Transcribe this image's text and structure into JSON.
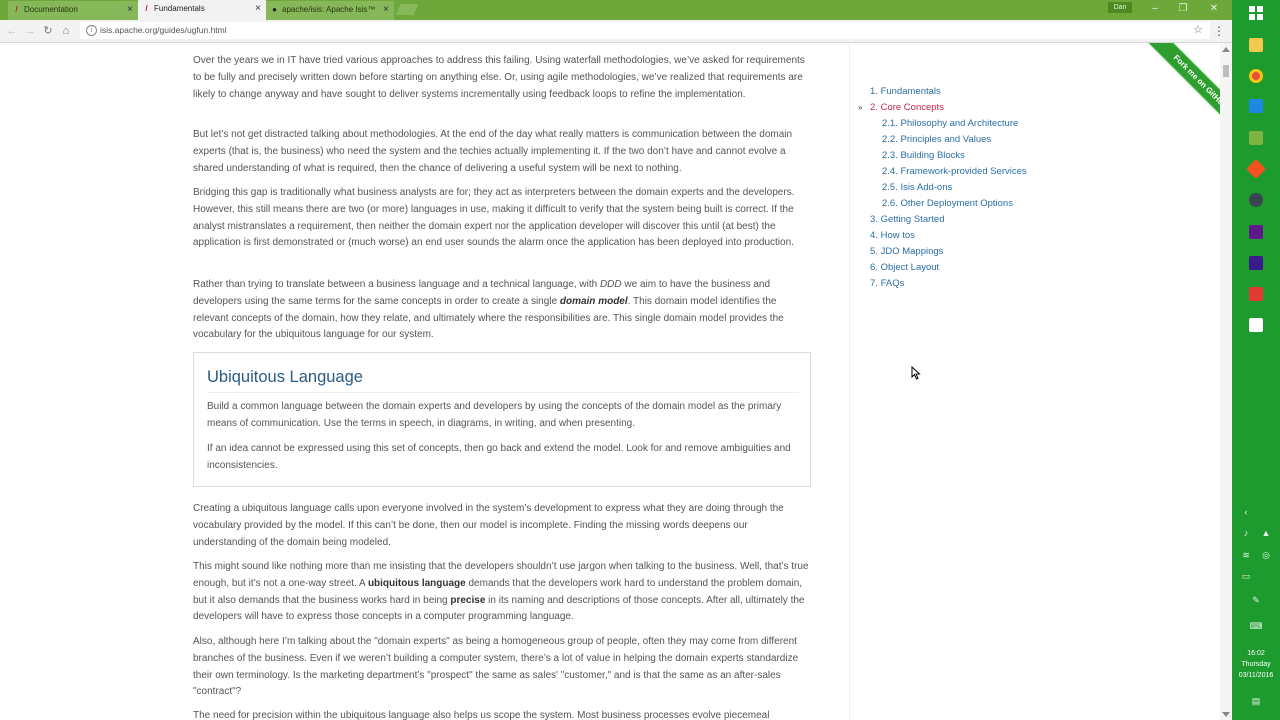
{
  "browser": {
    "tabs": [
      {
        "title": "Documentation",
        "active": false,
        "icon": "isis-favicon"
      },
      {
        "title": "Fundamentals",
        "active": true,
        "icon": "isis-favicon"
      },
      {
        "title": "apache/isis: Apache Isis™",
        "active": false,
        "icon": "github-icon"
      }
    ],
    "user_label": "Dan",
    "url": "isis.apache.org/guides/ugfun.html"
  },
  "page": {
    "paragraphs": [
      "Over the years we in IT have tried various approaches to address this failing. Using waterfall methodologies, we’ve asked for requirements to be fully and precisely written down before starting on anything else. Or, using agile methodologies, we’ve realized that requirements are likely to change anyway and have sought to deliver systems incrementally using feedback loops to refine the implementation.",
      "But let’s not get distracted talking about methodologies. At the end of the day what really matters is communication between the domain experts (that is, the business) who need the system and the techies actually implementing it. If the two don’t have and cannot evolve a shared understanding of what is required, then the chance of delivering a useful system will be next to nothing.",
      "Bridging this gap is traditionally what business analysts are for; they act as interpreters between the domain experts and the developers. However, this still means there are two (or more) languages in use, making it difficult to verify that the system being built is correct. If the analyst mistranslates a requirement, then neither the domain expert nor the application developer will discover this until (at best) the application is first demonstrated or (much worse) an end user sounds the alarm once the application has been deployed into production."
    ],
    "p4": {
      "a": "Rather than trying to translate between a business language and a technical language, with ",
      "ddd": "DDD",
      "b": " we aim to have the business and developers using the same terms for the same concepts in order to create a single ",
      "domain_model": "domain model",
      "c": ". This domain model identifies the relevant concepts of the domain, how they relate, and ultimately where the responsibilities are. This single domain model provides the vocabulary for the ubiquitous language for our system."
    },
    "callout": {
      "title": "Ubiquitous Language",
      "p1": "Build a common language between the domain experts and developers by using the concepts of the domain model as the primary means of communication. Use the terms in speech, in diagrams, in writing, and when presenting.",
      "p2": "If an idea cannot be expressed using this set of concepts, then go back and extend the model. Look for and remove ambiguities and inconsistencies."
    },
    "p5": "Creating a ubiquitous language calls upon everyone involved in the system’s development to express what they are doing through the vocabulary provided by the model. If this can’t be done, then our model is incomplete. Finding the missing words deepens our understanding of the domain being modeled.",
    "p6": {
      "a": "This might sound like nothing more than me insisting that the developers shouldn’t use jargon when talking to the business. Well, that’s true enough, but it’s not a one-way street. A ",
      "ul": "ubiquitous language",
      "b": " demands that the developers work hard to understand the problem domain, but it also demands that the business works hard in being ",
      "precise": "precise",
      "c": " in its naming and descriptions of those concepts. After all, ultimately the developers will have to express those concepts in a computer programming language."
    },
    "p7": "Also, although here I’m talking about the \"domain experts\" as being a homogeneous group of people, often they may come from different branches of the business. Even if we weren’t building a computer system, there’s a lot of value in helping the domain experts standardize their own terminology. Is the marketing department’s \"prospect\" the same as sales' \"customer,\" and is that the same as an after-sales \"contract\"?",
    "p8": "The need for precision within the ubiquitous language also helps us scope the system. Most business processes evolve piecemeal"
  },
  "toc": [
    {
      "num": "1.",
      "label": "Fundamentals",
      "level": 1,
      "active": false
    },
    {
      "num": "2.",
      "label": "Core Concepts",
      "level": 1,
      "active": true
    },
    {
      "num": "2.1.",
      "label": "Philosophy and Architecture",
      "level": 2,
      "active": false
    },
    {
      "num": "2.2.",
      "label": "Principles and Values",
      "level": 2,
      "active": false
    },
    {
      "num": "2.3.",
      "label": "Building Blocks",
      "level": 2,
      "active": false
    },
    {
      "num": "2.4.",
      "label": "Framework-provided Services",
      "level": 2,
      "active": false
    },
    {
      "num": "2.5.",
      "label": "Isis Add-ons",
      "level": 2,
      "active": false
    },
    {
      "num": "2.6.",
      "label": "Other Deployment Options",
      "level": 2,
      "active": false
    },
    {
      "num": "3.",
      "label": "Getting Started",
      "level": 1,
      "active": false
    },
    {
      "num": "4.",
      "label": "How tos",
      "level": 1,
      "active": false
    },
    {
      "num": "5.",
      "label": "JDO Mappings",
      "level": 1,
      "active": false
    },
    {
      "num": "6.",
      "label": "Object Layout",
      "level": 1,
      "active": false
    },
    {
      "num": "7.",
      "label": "FAQs",
      "level": 1,
      "active": false
    }
  ],
  "ribbon": "Fork me on GitHub",
  "taskbar": {
    "time": "16:02",
    "day": "Thursday",
    "date": "03/11/2016"
  },
  "colors": {
    "taskbar": "#1d9b2e",
    "titlebar": "#6ea83a",
    "link": "#2a6fa6",
    "active_link": "#c7254e",
    "ribbon": "#2e9e2e"
  }
}
